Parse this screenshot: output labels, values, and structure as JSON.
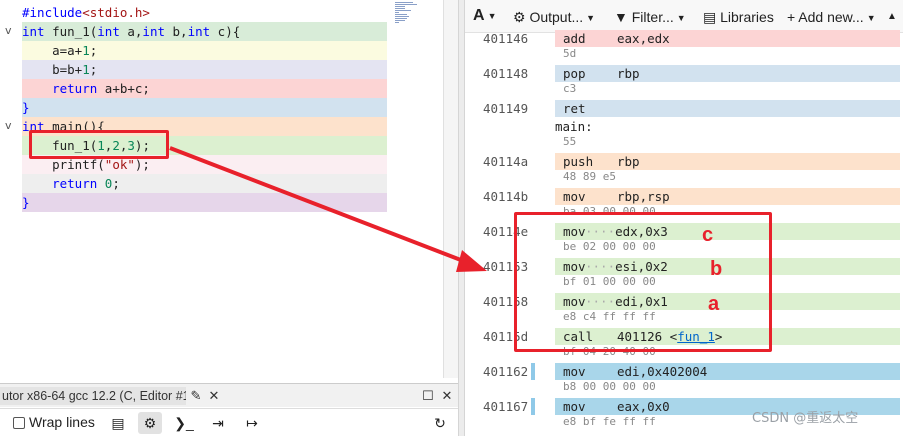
{
  "editor": {
    "lines": [
      {
        "text_parts": [
          [
            "pp",
            "#include"
          ],
          [
            "str",
            "<stdio.h>"
          ]
        ],
        "bg": "#ffffff"
      },
      {
        "text_parts": [
          [
            "kw",
            "int"
          ],
          [
            "fn",
            " fun_1("
          ],
          [
            "kw",
            "int"
          ],
          [
            "fn",
            " a,"
          ],
          [
            "kw",
            "int"
          ],
          [
            "fn",
            " b,"
          ],
          [
            "kw",
            "int"
          ],
          [
            "fn",
            " c){"
          ]
        ],
        "bg": "#d8ecd8",
        "fold": "v"
      },
      {
        "text_parts": [
          [
            "fn",
            "    a=a+"
          ],
          [
            "num",
            "1"
          ],
          [
            "fn",
            ";"
          ]
        ],
        "bg": "#fbfbe0"
      },
      {
        "text_parts": [
          [
            "fn",
            "    b=b+"
          ],
          [
            "num",
            "1"
          ],
          [
            "fn",
            ";"
          ]
        ],
        "bg": "#e4e4f2"
      },
      {
        "text_parts": [
          [
            "kw",
            "    return"
          ],
          [
            "fn",
            " a+b+c;"
          ]
        ],
        "bg": "#fcd4d4"
      },
      {
        "text_parts": [
          [
            "kw",
            "}"
          ]
        ],
        "bg": "#d2e2ef"
      },
      {
        "text_parts": [
          [
            "kw",
            "int"
          ],
          [
            "fn",
            " main(){"
          ]
        ],
        "bg": "#fde2cc",
        "fold": "v"
      },
      {
        "text_parts": [
          [
            "fn",
            "    fun_1("
          ],
          [
            "num",
            "1"
          ],
          [
            "fn",
            ","
          ],
          [
            "num",
            "2"
          ],
          [
            "fn",
            ","
          ],
          [
            "num",
            "3"
          ],
          [
            "fn",
            ");"
          ]
        ],
        "bg": "#dcf0d0"
      },
      {
        "text_parts": [
          [
            "fn",
            "    printf("
          ],
          [
            "str",
            "\"ok\""
          ],
          [
            "fn",
            ");"
          ]
        ],
        "bg": "#fbeef2"
      },
      {
        "text_parts": [
          [
            "kw",
            "    return"
          ],
          [
            "fn",
            " "
          ],
          [
            "num",
            "0"
          ],
          [
            "fn",
            ";"
          ]
        ],
        "bg": "#eeeeee"
      },
      {
        "text_parts": [
          [
            "kw",
            "}"
          ]
        ],
        "bg": "#e6d6ea"
      }
    ]
  },
  "compiler_tab": {
    "label": "utor x86-64 gcc 12.2 (C, Editor #1)",
    "edit_icon": "✎",
    "close_icon": "✕",
    "maximize_icon": "☐",
    "pane_close_icon": "✕"
  },
  "compiler_toolbar": {
    "wrap_label": "Wrap lines",
    "book_icon": "▤",
    "settings_icon": "⚙",
    "terminal_icon": "❯_",
    "login_icon": "⇥",
    "logout_icon": "↦",
    "refresh_icon": "↻"
  },
  "asm_toolbar": {
    "font_icon": "A",
    "output_label": "Output...",
    "filter_label": "Filter...",
    "libraries_label": "Libraries",
    "add_new_label": "Add new...",
    "more_icon": "▲"
  },
  "asm": [
    {
      "addr": "401146",
      "op": "add",
      "args": "eax,edx",
      "bytes": "5d",
      "bg": "#fcd4d4"
    },
    {
      "addr": "401148",
      "op": "pop",
      "args": "rbp",
      "bytes": "c3",
      "bg": "#d2e2ef"
    },
    {
      "addr": "401149",
      "op": "ret",
      "args": "",
      "bytes": "",
      "bg": "#d2e2ef"
    },
    {
      "label": "main:"
    },
    {
      "addr": "",
      "op": "",
      "args": "",
      "bytes": "55",
      "bg": ""
    },
    {
      "addr": "40114a",
      "op": "push",
      "args": "rbp",
      "bytes": "48 89 e5",
      "bg": "#fde2cc"
    },
    {
      "addr": "40114b",
      "op": "mov",
      "args": "rbp,rsp",
      "bytes": "ba 03 00 00 00",
      "bg": "#fde2cc"
    },
    {
      "addr": "40114e",
      "op": "mov",
      "args": "edx,0x3",
      "bytes": "be 02 00 00 00",
      "bg": "#dcf0d0",
      "dots": true
    },
    {
      "addr": "401153",
      "op": "mov",
      "args": "esi,0x2",
      "bytes": "bf 01 00 00 00",
      "bg": "#dcf0d0",
      "dots": true
    },
    {
      "addr": "401158",
      "op": "mov",
      "args": "edi,0x1",
      "bytes": "e8 c4 ff ff ff",
      "bg": "#dcf0d0",
      "dots": true
    },
    {
      "addr": "40115d",
      "op": "call",
      "args": "401126 <",
      "link": "fun_1",
      "args_after": ">",
      "bytes": "bf 04 20 40 00",
      "bg": "#dcf0d0"
    },
    {
      "addr": "401162",
      "op": "mov",
      "args": "edi,0x402004",
      "bytes": "b8 00 00 00 00",
      "bg": "#a9d6ea",
      "mark": true
    },
    {
      "addr": "401167",
      "op": "mov",
      "args": "eax,0x0",
      "bytes": "e8 bf fe ff ff",
      "bg": "#a9d6ea",
      "mark": true
    }
  ],
  "annotations": {
    "c": "c",
    "b": "b",
    "a": "a"
  },
  "watermark": "CSDN @重返太空",
  "colors": {
    "highlight_red": "#e8212b"
  }
}
